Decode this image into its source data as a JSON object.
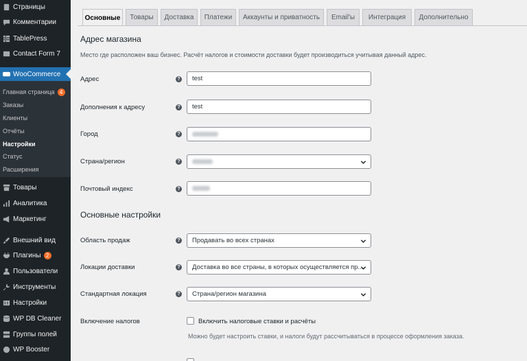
{
  "sidebar": {
    "items_top": [
      {
        "label": "Страницы",
        "icon": "pages-icon"
      },
      {
        "label": "Комментарии",
        "icon": "comments-icon"
      },
      {
        "label": "TablePress",
        "icon": "table-icon"
      },
      {
        "label": "Contact Form 7",
        "icon": "mail-icon"
      },
      {
        "label": "WooCommerce",
        "icon": "woocommerce-icon"
      }
    ],
    "submenu": [
      {
        "label": "Главная страница",
        "badge": "4"
      },
      {
        "label": "Заказы"
      },
      {
        "label": "Клиенты"
      },
      {
        "label": "Отчёты"
      },
      {
        "label": "Настройки"
      },
      {
        "label": "Статус"
      },
      {
        "label": "Расширения"
      }
    ],
    "items_bottom": [
      {
        "label": "Товары",
        "icon": "archive-icon"
      },
      {
        "label": "Аналитика",
        "icon": "chart-icon"
      },
      {
        "label": "Маркетинг",
        "icon": "megaphone-icon"
      },
      {
        "label": "Внешний вид",
        "icon": "brush-icon"
      },
      {
        "label": "Плагины",
        "icon": "plugin-icon",
        "badge": "2"
      },
      {
        "label": "Пользователи",
        "icon": "users-icon"
      },
      {
        "label": "Инструменты",
        "icon": "wrench-icon"
      },
      {
        "label": "Настройки",
        "icon": "settings-icon"
      },
      {
        "label": "WP DB Cleaner",
        "icon": "database-icon"
      },
      {
        "label": "Группы полей",
        "icon": "fields-icon"
      },
      {
        "label": "WP Booster",
        "icon": "booster-icon"
      }
    ]
  },
  "tabs": [
    "Основные",
    "Товары",
    "Доставка",
    "Платежи",
    "Аккаунты и приватность",
    "Email'ы",
    "Интеграция",
    "Дополнительно"
  ],
  "store_address": {
    "title": "Адрес магазина",
    "description": "Место где расположен ваш бизнес. Расчёт налогов и стоимости доставки будет производиться учитывая данный адрес.",
    "fields": [
      {
        "label": "Адрес",
        "value": "test"
      },
      {
        "label": "Дополнения к адресу",
        "value": "test"
      },
      {
        "label": "Город",
        "value": ""
      },
      {
        "label": "Страна/регион",
        "value": ""
      },
      {
        "label": "Почтовый индекс",
        "value": ""
      }
    ]
  },
  "general_settings": {
    "title": "Основные настройки",
    "fields": [
      {
        "label": "Область продаж",
        "value": "Продавать во всех странах"
      },
      {
        "label": "Локации доставки",
        "value": "Доставка во все страны, в которых осуществляется пр..."
      },
      {
        "label": "Стандартная локация",
        "value": "Страна/регион магазина"
      }
    ],
    "taxes": {
      "label": "Включение налогов",
      "checkbox_label": "Включить налоговые ставки и расчёты",
      "description": "Можно будет настроить ставки, и налоги будут рассчитываться в процессе оформления заказа."
    }
  },
  "help_glyph": "?",
  "colors": {
    "accent": "#2271b1",
    "sidebar": "#1d2327",
    "badge_orange": "#f56e28",
    "badge_red": "#d63638"
  }
}
